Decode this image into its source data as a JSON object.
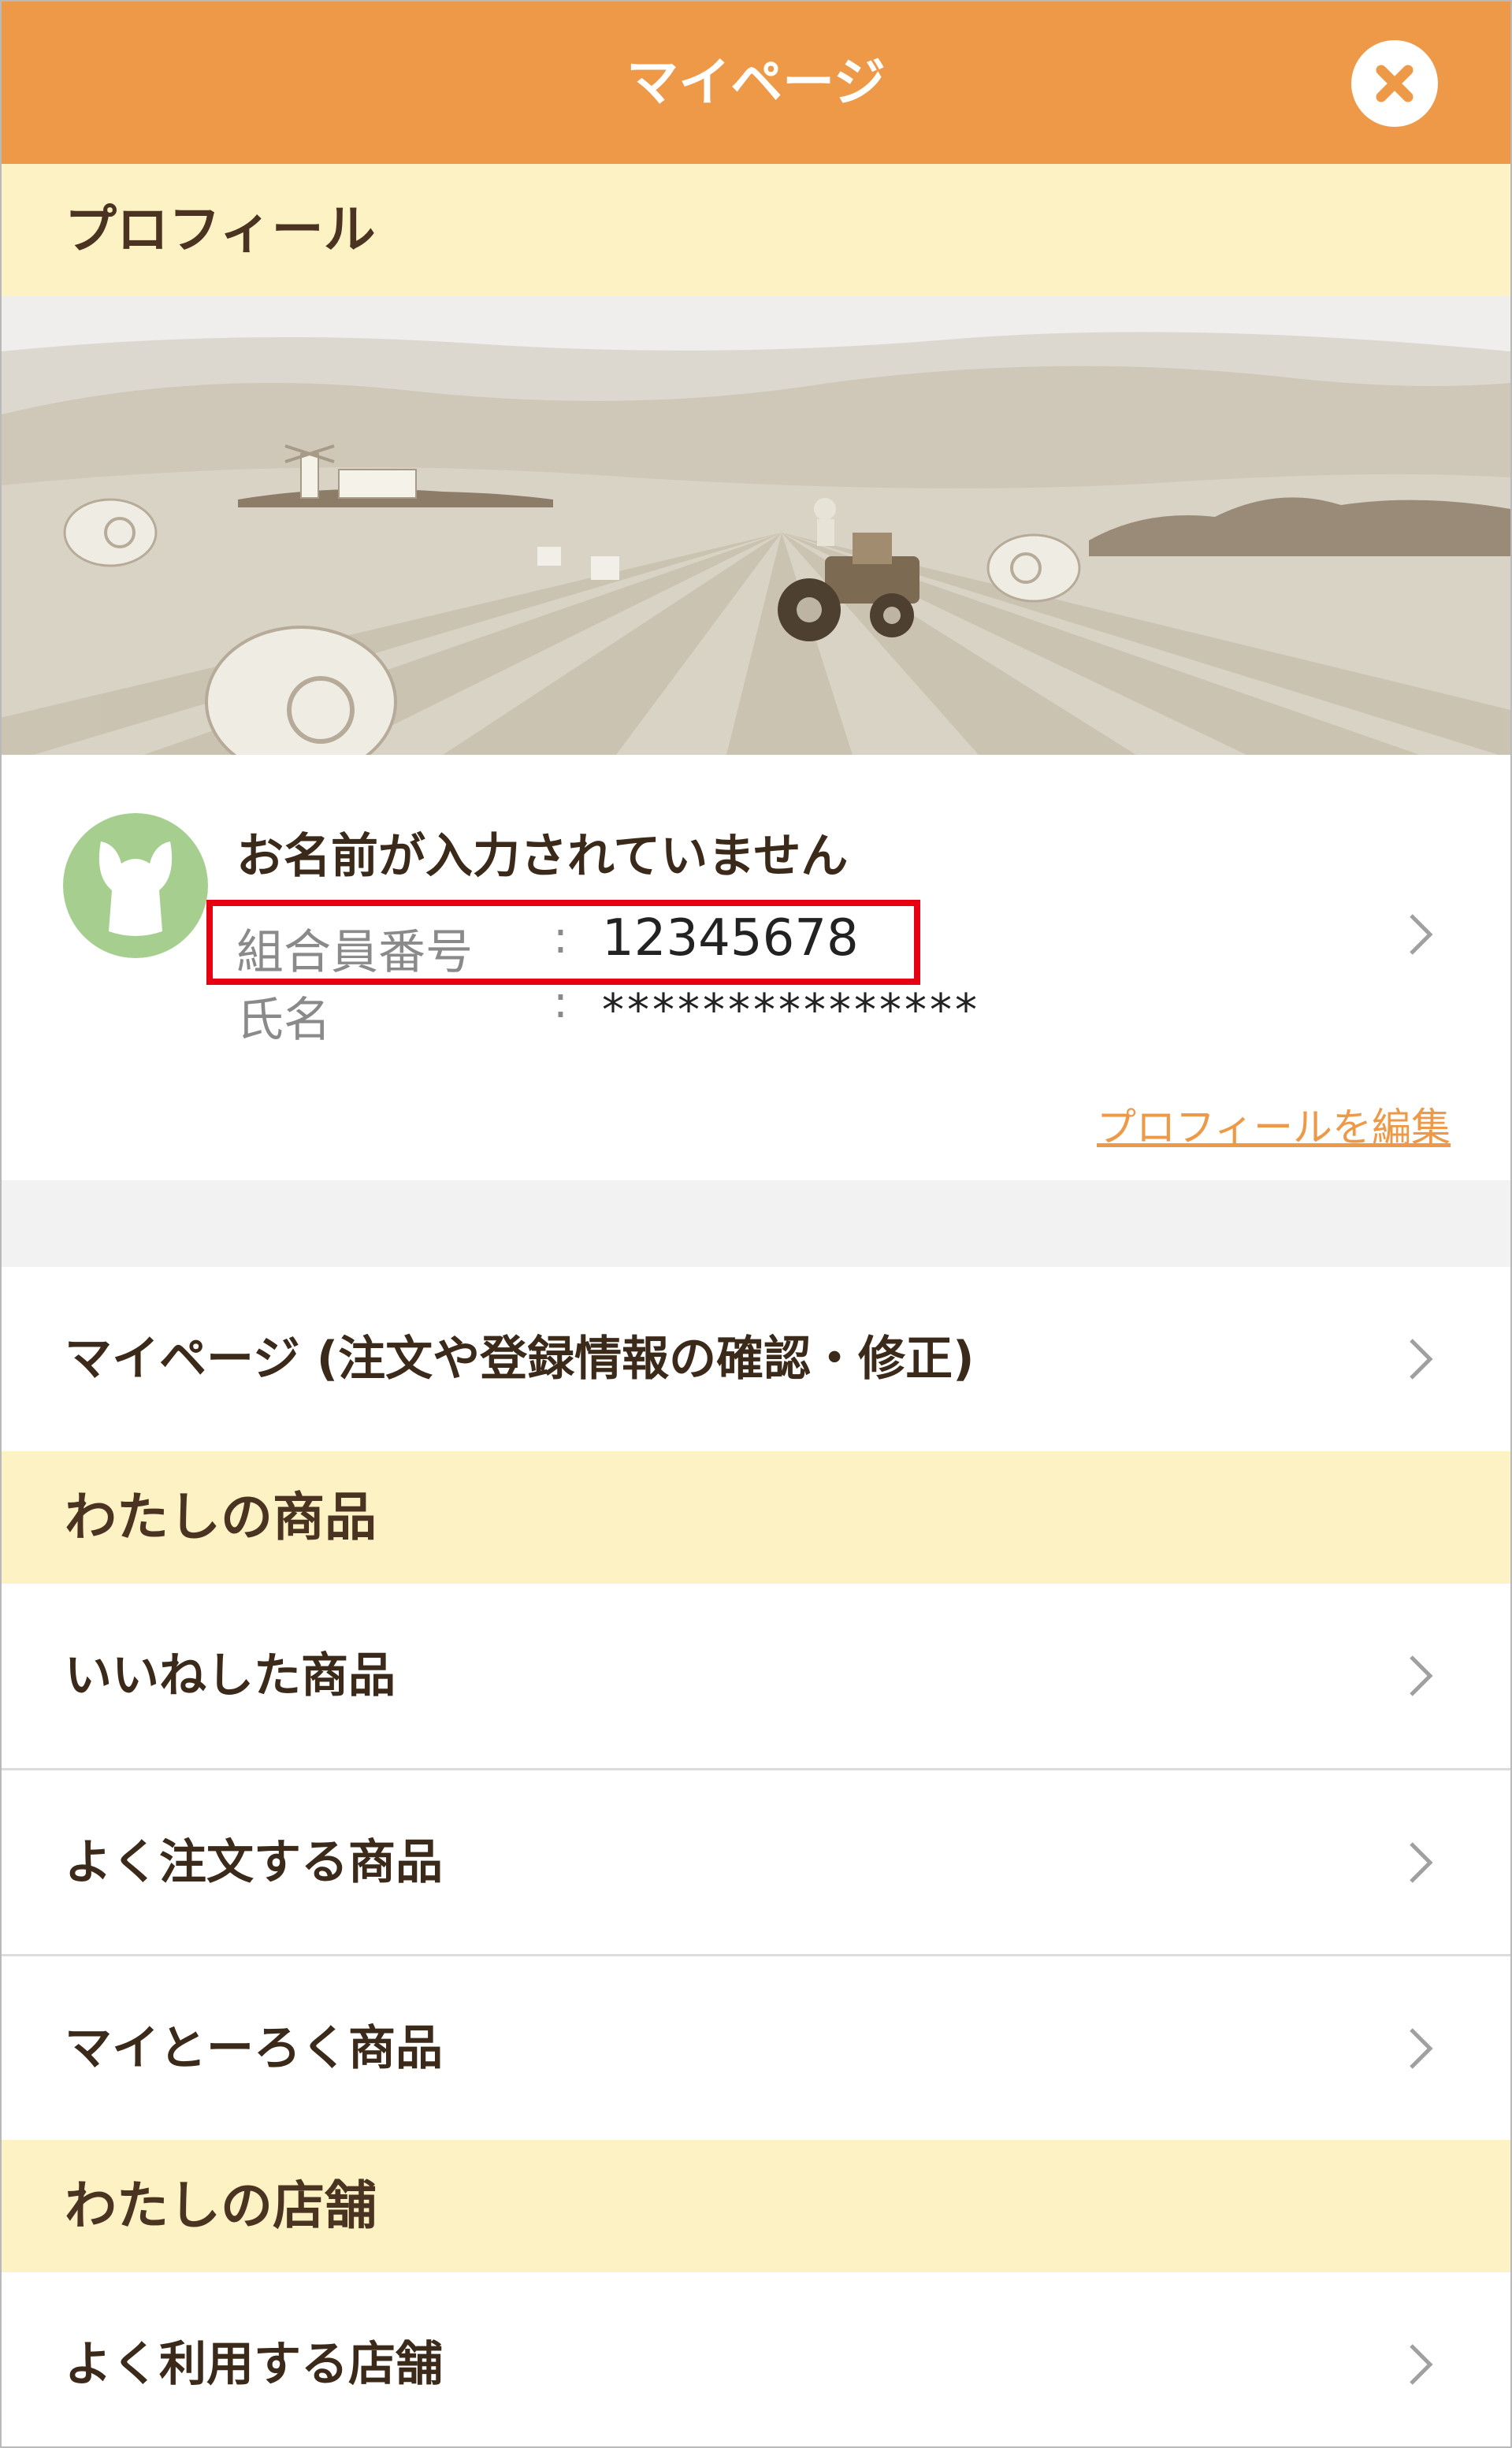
{
  "header": {
    "title": "マイページ",
    "close_icon": "close-icon",
    "accent_color": "#ee9948"
  },
  "profile_section": {
    "heading": "プロフィール",
    "name": "お名前が入力されていません",
    "member_number_label": "組合員番号",
    "member_number_value": "12345678",
    "full_name_label": "氏名",
    "full_name_value": "***************",
    "colon": ":",
    "edit_link": "プロフィールを編集",
    "avatar_icon": "co-op-mascot-icon",
    "banner_image": "farm-field-tractor-illustration"
  },
  "menu": {
    "mypage_item": "マイページ (注文や登録情報の確認・修正)"
  },
  "my_products": {
    "heading": "わたしの商品",
    "items": [
      "いいねした商品",
      "よく注文する商品",
      "マイとーろく商品"
    ]
  },
  "my_stores": {
    "heading": "わたしの店舗",
    "items": [
      "よく利用する店舗"
    ]
  },
  "colors": {
    "section_bg": "#fdf2c4",
    "highlight": "#e60012"
  }
}
